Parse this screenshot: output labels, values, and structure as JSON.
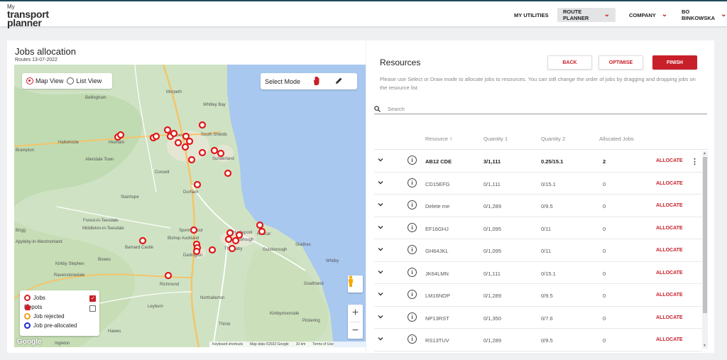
{
  "header": {
    "logo": {
      "line1": "My",
      "line2": "transport",
      "line3": "planner"
    },
    "nav": [
      {
        "label": "MY UTILITIES"
      },
      {
        "label": "ROUTE PLANNER"
      },
      {
        "label": "COMPANY"
      },
      {
        "label": "BO BINKOWSKA"
      }
    ]
  },
  "jobs": {
    "title": "Jobs allocation",
    "subtitle": "Routes 13-07-2022",
    "view_options": [
      "Map View",
      "List View"
    ],
    "selected_view": "Map View",
    "select_mode_label": "Select Mode",
    "legend": [
      {
        "label": "Jobs",
        "color": "#d0202a",
        "checked": true
      },
      {
        "label": "Depots",
        "color": "#d0202a",
        "checked": false
      },
      {
        "label": "Job rejected",
        "color": "#f0a020"
      },
      {
        "label": "Job pre-allocated",
        "color": "#1a2ad0"
      }
    ],
    "map": {
      "brand": "Google",
      "attribution": [
        "Keyboard shortcuts",
        "Map data ©2022 Google",
        "10 km",
        "Terms of Use"
      ],
      "places": [
        "Morpeth",
        "Whitley Bay",
        "South Shields",
        "Bellingham",
        "Hexham",
        "Haltwhistle",
        "Brampton",
        "Newcastle",
        "Sunderland",
        "Allendale Town",
        "Consett",
        "Stanhope",
        "Durham",
        "Spennymoor",
        "Hartlepool",
        "Forest-in-Teesdale",
        "Middleton-in-Teesdale",
        "Bishop Auckland",
        "Appleby-in-Westmorland",
        "Barnard Castle",
        "Darlington",
        "Middlesbrough",
        "Thornaby",
        "Redcar",
        "Guisborough",
        "Staithes",
        "Whitby",
        "Kirkby Stephen",
        "Ravenstonedale",
        "Richmond",
        "Leyburn",
        "Northallerton",
        "Thirsk",
        "Goathland",
        "Kirkbymoorside",
        "Pickering",
        "Ingleton",
        "Hawes",
        "Brigg",
        "Bowes"
      ]
    }
  },
  "resources": {
    "title": "Resources",
    "buttons": {
      "back": "BACK",
      "optimise": "OPTIMISE",
      "finish": "FINISH"
    },
    "help": "Please use Select or Draw mode to allocate jobs to resources. You can still change the order of jobs by dragging and dropping jobs on the resource list",
    "search_placeholder": "Search",
    "columns": [
      "Resource",
      "Quantity 1",
      "Quantity 2",
      "Allocated Jobs"
    ],
    "action_label": "ALLOCATE",
    "rows": [
      {
        "name": "AB12 CDE",
        "q1": "3/1,111",
        "q2": "0.25/15.1",
        "jobs": "2"
      },
      {
        "name": "CD15EFG",
        "q1": "0/1,111",
        "q2": "0/15.1",
        "jobs": "0"
      },
      {
        "name": "Delete me",
        "q1": "0/1,289",
        "q2": "0/9.5",
        "jobs": "0"
      },
      {
        "name": "EF16GHJ",
        "q1": "0/1,095",
        "q2": "0/11",
        "jobs": "0"
      },
      {
        "name": "GH64JKL",
        "q1": "0/1,095",
        "q2": "0/11",
        "jobs": "0"
      },
      {
        "name": "JK64LMN",
        "q1": "0/1,111",
        "q2": "0/15.1",
        "jobs": "0"
      },
      {
        "name": "LM16NOP",
        "q1": "0/1,289",
        "q2": "0/9.5",
        "jobs": "0"
      },
      {
        "name": "NP13RST",
        "q1": "0/1,350",
        "q2": "0/7.6",
        "jobs": "0"
      },
      {
        "name": "RS13TUV",
        "q1": "0/1,289",
        "q2": "0/9.5",
        "jobs": "0"
      }
    ]
  },
  "colors": {
    "brand": "#c8202a",
    "header_border": "#1e4a5a",
    "map_land": "#cfe3c4",
    "map_sea": "#a8c8f0"
  }
}
